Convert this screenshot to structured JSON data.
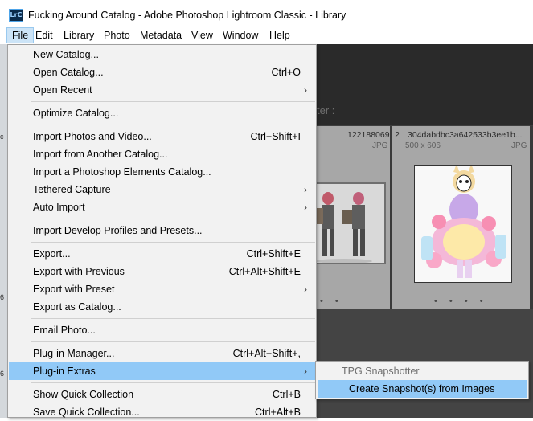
{
  "window": {
    "app_icon_text": "LrC",
    "title": "Fucking Around Catalog - Adobe Photoshop Lightroom Classic - Library"
  },
  "menubar": {
    "items": [
      "File",
      "Edit",
      "Library",
      "Photo",
      "Metadata",
      "View",
      "Window",
      "Help"
    ],
    "active": "File"
  },
  "file_menu": {
    "items": [
      {
        "label": "New Catalog...",
        "shortcut": "",
        "submenu": false
      },
      {
        "label": "Open Catalog...",
        "shortcut": "Ctrl+O",
        "submenu": false
      },
      {
        "label": "Open Recent",
        "shortcut": "",
        "submenu": true
      },
      {
        "label": "Optimize Catalog...",
        "shortcut": "",
        "submenu": false
      },
      {
        "label": "Import Photos and Video...",
        "shortcut": "Ctrl+Shift+I",
        "submenu": false
      },
      {
        "label": "Import from Another Catalog...",
        "shortcut": "",
        "submenu": false
      },
      {
        "label": "Import a Photoshop Elements Catalog...",
        "shortcut": "",
        "submenu": false
      },
      {
        "label": "Tethered Capture",
        "shortcut": "",
        "submenu": true
      },
      {
        "label": "Auto Import",
        "shortcut": "",
        "submenu": true
      },
      {
        "label": "Import Develop Profiles and Presets...",
        "shortcut": "",
        "submenu": false
      },
      {
        "label": "Export...",
        "shortcut": "Ctrl+Shift+E",
        "submenu": false
      },
      {
        "label": "Export with Previous",
        "shortcut": "Ctrl+Alt+Shift+E",
        "submenu": false
      },
      {
        "label": "Export with Preset",
        "shortcut": "",
        "submenu": true
      },
      {
        "label": "Export as Catalog...",
        "shortcut": "",
        "submenu": false
      },
      {
        "label": "Email Photo...",
        "shortcut": "",
        "submenu": false
      },
      {
        "label": "Plug-in Manager...",
        "shortcut": "Ctrl+Alt+Shift+,",
        "submenu": false
      },
      {
        "label": "Plug-in Extras",
        "shortcut": "",
        "submenu": true
      },
      {
        "label": "Show Quick Collection",
        "shortcut": "Ctrl+B",
        "submenu": false
      },
      {
        "label": "Save Quick Collection...",
        "shortcut": "Ctrl+Alt+B",
        "submenu": false
      }
    ],
    "highlighted": "Plug-in Extras"
  },
  "plugin_extras_submenu": {
    "header": "TPG Snapshotter",
    "item": "Create Snapshot(s) from Images"
  },
  "library": {
    "filter_label": "ter :",
    "cells": [
      {
        "number": "122188069",
        "format": "JPG"
      },
      {
        "number": "2",
        "filename": "304dabdbc3a642533b3ee1b...",
        "dimensions": "500 x 606",
        "format": "JPG"
      }
    ]
  },
  "desktop_strip": [
    "c",
    "6",
    "6"
  ],
  "colors": {
    "menu_bg": "#f2f2f2",
    "menu_highlight": "#91c9f7",
    "active_menu": "#cce4f7",
    "lr_dark": "#3e3e3e",
    "cell_bg": "#a7a7a7"
  }
}
